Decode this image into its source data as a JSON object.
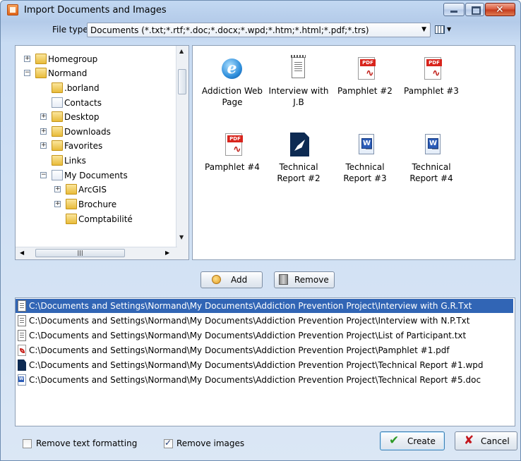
{
  "window": {
    "title": "Import Documents and Images",
    "icons": {
      "app": "import-app-icon",
      "minimize": "minimize-icon",
      "maximize": "maximize-icon",
      "close": "close-icon"
    }
  },
  "filetype": {
    "label": "File type:",
    "value": "Documents (*.txt;*.rtf;*.doc;*.docx;*.wpd;*.htm;*.html;*.pdf;*.trs)"
  },
  "tree": {
    "items": [
      {
        "label": "Homegroup",
        "icon": "homegroup-icon",
        "expander": "+"
      },
      {
        "label": "Normand",
        "icon": "user-folder-icon",
        "expander": "-"
      },
      {
        "label": ".borland",
        "icon": "folder-icon",
        "expander": ""
      },
      {
        "label": "Contacts",
        "icon": "contacts-folder-icon",
        "expander": ""
      },
      {
        "label": "Desktop",
        "icon": "desktop-folder-icon",
        "expander": "+"
      },
      {
        "label": "Downloads",
        "icon": "downloads-folder-icon",
        "expander": "+"
      },
      {
        "label": "Favorites",
        "icon": "favorites-folder-icon",
        "expander": "+"
      },
      {
        "label": "Links",
        "icon": "links-folder-icon",
        "expander": ""
      },
      {
        "label": "My Documents",
        "icon": "documents-folder-icon",
        "expander": "-"
      },
      {
        "label": "ArcGIS",
        "icon": "folder-icon",
        "expander": "+"
      },
      {
        "label": "Brochure",
        "icon": "folder-icon",
        "expander": "+"
      },
      {
        "label": "Comptabilité",
        "icon": "folder-icon",
        "expander": ""
      }
    ]
  },
  "files": [
    {
      "label": "Addiction Web Page",
      "icon": "html-file-icon"
    },
    {
      "label": "Interview with J.B",
      "icon": "text-file-icon"
    },
    {
      "label": "Pamphlet #2",
      "icon": "pdf-file-icon"
    },
    {
      "label": "Pamphlet #3",
      "icon": "pdf-file-icon"
    },
    {
      "label": "Pamphlet #4",
      "icon": "pdf-file-icon"
    },
    {
      "label": "Technical Report #2",
      "icon": "wpd-file-icon"
    },
    {
      "label": "Technical Report #3",
      "icon": "word-file-icon"
    },
    {
      "label": "Technical Report #4",
      "icon": "word-file-icon"
    }
  ],
  "actions": {
    "add": "Add",
    "remove": "Remove"
  },
  "selected_files": [
    {
      "path": "C:\\Documents and Settings\\Normand\\My Documents\\Addiction Prevention Project\\Interview with G.R.Txt",
      "icon": "text-file-icon",
      "selected": true
    },
    {
      "path": "C:\\Documents and Settings\\Normand\\My Documents\\Addiction Prevention Project\\Interview with N.P.Txt",
      "icon": "text-file-icon",
      "selected": false
    },
    {
      "path": "C:\\Documents and Settings\\Normand\\My Documents\\Addiction Prevention Project\\List of Participant.txt",
      "icon": "text-file-icon",
      "selected": false
    },
    {
      "path": "C:\\Documents and Settings\\Normand\\My Documents\\Addiction Prevention Project\\Pamphlet #1.pdf",
      "icon": "pdf-file-icon",
      "selected": false
    },
    {
      "path": "C:\\Documents and Settings\\Normand\\My Documents\\Addiction Prevention Project\\Technical Report #1.wpd",
      "icon": "wpd-file-icon",
      "selected": false
    },
    {
      "path": "C:\\Documents and Settings\\Normand\\My Documents\\Addiction Prevention Project\\Technical Report #5.doc",
      "icon": "word-file-icon",
      "selected": false
    }
  ],
  "options": {
    "remove_formatting": {
      "label": "Remove text formatting",
      "checked": false
    },
    "remove_images": {
      "label": "Remove images",
      "checked": true
    }
  },
  "buttons": {
    "create": "Create",
    "cancel": "Cancel"
  },
  "colors": {
    "selection": "#3165b5",
    "create_check": "#2d9a26",
    "cancel_x": "#c3161c"
  }
}
